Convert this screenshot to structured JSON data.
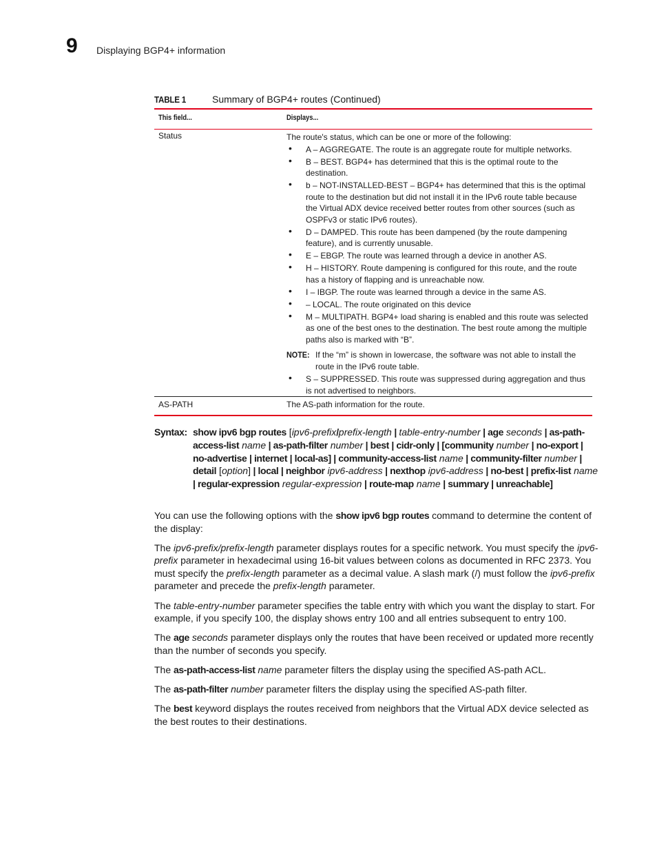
{
  "header": {
    "chapter_number": "9",
    "chapter_title": "Displaying BGP4+ information"
  },
  "table": {
    "label": "TABLE 1",
    "title": "Summary of BGP4+ routes  (Continued)",
    "columns": [
      "This field...",
      "Displays..."
    ],
    "accent_color": "#e2001a",
    "rows": [
      {
        "field": "Status",
        "intro": "The route's status, which can be one or more of the following:",
        "items": [
          "A – AGGREGATE. The route is an aggregate route for multiple networks.",
          "B – BEST. BGP4+ has determined that this is the optimal route to the destination.",
          "b – NOT-INSTALLED-BEST – BGP4+ has determined that this is the optimal route to the destination but did not install it in the IPv6 route table because the Virtual ADX device received better routes from other sources (such as OSPFv3 or static IPv6 routes).",
          "D – DAMPED. This route has been dampened (by the route dampening feature), and is currently unusable.",
          "E – EBGP. The route was learned through a device in another AS.",
          "H – HISTORY. Route dampening is configured for this route, and the route has a history of flapping and is unreachable now.",
          "I – IBGP. The route was learned through a device in the same AS.",
          " – LOCAL. The route originated on this device",
          "M – MULTIPATH. BGP4+ load sharing is enabled and this route was selected as one of the best ones to the destination. The best route among the multiple paths also is marked with “B”."
        ],
        "note_label": "NOTE:",
        "note_text": "If the “m” is shown in lowercase, the software was not able to install the route in the IPv6 route table.",
        "items_after_note": [
          "S – SUPPRESSED. This route was suppressed during aggregation and thus is not advertised to neighbors."
        ]
      },
      {
        "field": "AS-PATH",
        "description": "The AS-path information for the route."
      }
    ]
  },
  "syntax": {
    "label": "Syntax:",
    "segments": [
      {
        "t": "show ipv6 bgp routes",
        "s": "b"
      },
      {
        "t": " [",
        "s": ""
      },
      {
        "t": "ipv6-prefix",
        "s": "i"
      },
      {
        "t": "/",
        "s": "b"
      },
      {
        "t": "prefix-length",
        "s": "i"
      },
      {
        "t": " | ",
        "s": "b"
      },
      {
        "t": "table-entry-number",
        "s": "i"
      },
      {
        "t": " | ",
        "s": "b"
      },
      {
        "t": "age",
        "s": "b"
      },
      {
        "t": " seconds",
        "s": "i"
      },
      {
        "t": " | ",
        "s": "b"
      },
      {
        "t": "as-path-access-list",
        "s": "b"
      },
      {
        "t": " name",
        "s": "i"
      },
      {
        "t": " | as-path-filter",
        "s": "b"
      },
      {
        "t": " number",
        "s": "i"
      },
      {
        "t": " | best | cidr-only | [community",
        "s": "b"
      },
      {
        "t": " number",
        "s": "i"
      },
      {
        "t": " | no-export | no-advertise | internet | local-as] | community-access-list",
        "s": "b"
      },
      {
        "t": " name",
        "s": "i"
      },
      {
        "t": " | community-filter",
        "s": "b"
      },
      {
        "t": " number",
        "s": "i"
      },
      {
        "t": " | detail",
        "s": "b"
      },
      {
        "t": " [",
        "s": ""
      },
      {
        "t": "option",
        "s": "i"
      },
      {
        "t": "]",
        "s": ""
      },
      {
        "t": " | local | neighbor",
        "s": "b"
      },
      {
        "t": " ipv6-address",
        "s": "i"
      },
      {
        "t": " | nexthop",
        "s": "b"
      },
      {
        "t": " ipv6-address",
        "s": "i"
      },
      {
        "t": " | no-best | prefix-list",
        "s": "b"
      },
      {
        "t": " name",
        "s": "i"
      },
      {
        "t": " | regular-expression",
        "s": "b"
      },
      {
        "t": " regular-expression",
        "s": "i"
      },
      {
        "t": " | route-map",
        "s": "b"
      },
      {
        "t": " name",
        "s": "i"
      },
      {
        "t": " | summary | unreachable]",
        "s": "b"
      }
    ]
  },
  "paragraphs": [
    [
      {
        "t": "You can use the following options with the ",
        "s": ""
      },
      {
        "t": "show ipv6 bgp routes",
        "s": "b"
      },
      {
        "t": " command to determine the content of the display:",
        "s": ""
      }
    ],
    [
      {
        "t": "The ",
        "s": ""
      },
      {
        "t": "ipv6-prefix/prefix-length",
        "s": "i"
      },
      {
        "t": " parameter displays routes for a specific network. You must specify the ",
        "s": ""
      },
      {
        "t": "ipv6-prefix",
        "s": "i"
      },
      {
        "t": " parameter in hexadecimal using 16-bit values between colons as documented in RFC 2373. You must specify the ",
        "s": ""
      },
      {
        "t": "prefix-length",
        "s": "i"
      },
      {
        "t": " parameter as a decimal value. A slash mark (/) must follow the ",
        "s": ""
      },
      {
        "t": "ipv6-prefix",
        "s": "i"
      },
      {
        "t": " parameter and precede the ",
        "s": ""
      },
      {
        "t": "prefix-length",
        "s": "i"
      },
      {
        "t": " parameter.",
        "s": ""
      }
    ],
    [
      {
        "t": "The ",
        "s": ""
      },
      {
        "t": "table-entry-number",
        "s": "i"
      },
      {
        "t": " parameter specifies the table entry with which you want the display to start. For example, if you specify 100, the display shows entry 100 and all entries subsequent to entry 100.",
        "s": ""
      }
    ],
    [
      {
        "t": "The ",
        "s": ""
      },
      {
        "t": "age",
        "s": "b"
      },
      {
        "t": " seconds",
        "s": "i"
      },
      {
        "t": " parameter displays only the routes that have been received or updated more recently than the number of seconds you specify.",
        "s": ""
      }
    ],
    [
      {
        "t": "The ",
        "s": ""
      },
      {
        "t": "as-path-access-list",
        "s": "b"
      },
      {
        "t": " name",
        "s": "i"
      },
      {
        "t": " parameter filters the display using the specified AS-path ACL.",
        "s": ""
      }
    ],
    [
      {
        "t": "The ",
        "s": ""
      },
      {
        "t": "as-path-filter",
        "s": "b"
      },
      {
        "t": " number",
        "s": "i"
      },
      {
        "t": " parameter filters the display using the specified AS-path filter.",
        "s": ""
      }
    ],
    [
      {
        "t": "The ",
        "s": ""
      },
      {
        "t": "best",
        "s": "b"
      },
      {
        "t": " keyword displays the routes received from neighbors that the Virtual ADX device selected as the best routes to their destinations.",
        "s": ""
      }
    ]
  ]
}
